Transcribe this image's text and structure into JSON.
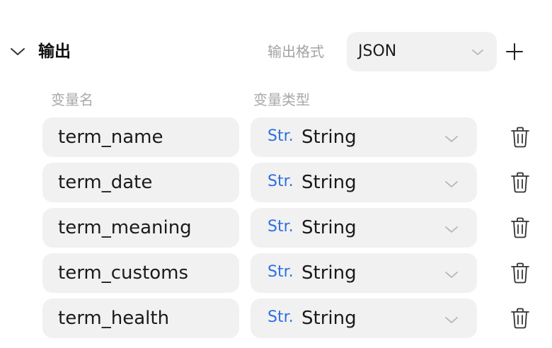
{
  "section": {
    "title": "输出",
    "format_label": "输出格式",
    "format_value": "JSON"
  },
  "columns": {
    "name": "变量名",
    "type": "变量类型"
  },
  "rows": [
    {
      "name": "term_name",
      "type_badge": "Str.",
      "type": "String"
    },
    {
      "name": "term_date",
      "type_badge": "Str.",
      "type": "String"
    },
    {
      "name": "term_meaning",
      "type_badge": "Str.",
      "type": "String"
    },
    {
      "name": "term_customs",
      "type_badge": "Str.",
      "type": "String"
    },
    {
      "name": "term_health",
      "type_badge": "Str.",
      "type": "String"
    }
  ],
  "icons": {
    "collapse": "chevron-down-icon",
    "dropdown": "chevron-down-icon",
    "add": "plus-icon",
    "delete": "trash-icon"
  },
  "colors": {
    "field_bg": "#f1f1f1",
    "type_badge": "#2f6fe0",
    "muted_text": "#a3a3a3"
  }
}
